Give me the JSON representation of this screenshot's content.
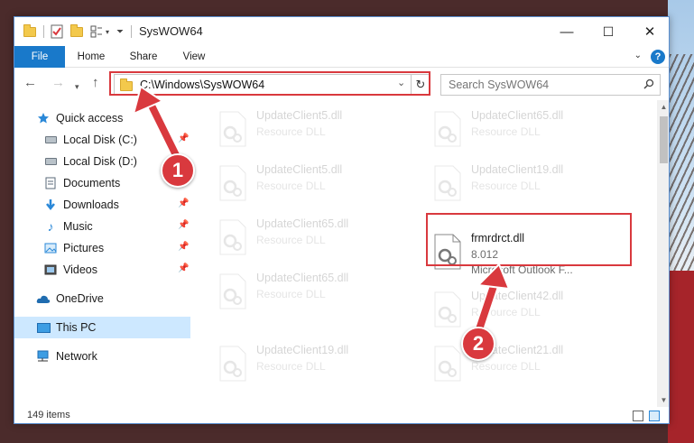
{
  "window": {
    "title": "SysWOW64",
    "buttons": {
      "minimize": "—",
      "maximize": "☐",
      "close": "✕"
    }
  },
  "ribbon": {
    "tabs": [
      {
        "label": "File"
      },
      {
        "label": "Home"
      },
      {
        "label": "Share"
      },
      {
        "label": "View"
      }
    ],
    "help": "?"
  },
  "navbar": {
    "address": "C:\\Windows\\SysWOW64",
    "search_placeholder": "Search SysWOW64"
  },
  "sidebar": {
    "items": [
      {
        "label": "Quick access",
        "icon": "star-icon"
      },
      {
        "label": "Local Disk (C:)",
        "icon": "disk-icon",
        "pinned": true
      },
      {
        "label": "Local Disk (D:)",
        "icon": "disk-icon",
        "pinned": false
      },
      {
        "label": "Documents",
        "icon": "documents-icon",
        "pinned": true
      },
      {
        "label": "Downloads",
        "icon": "downloads-icon",
        "pinned": true
      },
      {
        "label": "Music",
        "icon": "music-icon",
        "pinned": true
      },
      {
        "label": "Pictures",
        "icon": "pictures-icon",
        "pinned": true
      },
      {
        "label": "Videos",
        "icon": "videos-icon",
        "pinned": true
      },
      {
        "label": "OneDrive",
        "icon": "cloud-icon"
      },
      {
        "label": "This PC",
        "icon": "computer-icon",
        "selected": true
      },
      {
        "label": "Network",
        "icon": "network-icon"
      }
    ]
  },
  "files": [
    {
      "name": "UpdateClient5.dll",
      "desc": "Resource DLL"
    },
    {
      "name": "UpdateClient65.dll",
      "desc": "Resource DLL"
    },
    {
      "name": "UpdateClient5.dll",
      "desc": "Resource DLL"
    },
    {
      "name": "UpdateClient19.dll",
      "desc": "Resource DLL"
    },
    {
      "name": "UpdateClient65.dll",
      "desc": "Resource DLL"
    },
    {
      "name": "frmrdrct.dll",
      "desc": "8.012",
      "desc2": "Microsoft Outlook F..."
    },
    {
      "name": "UpdateClient65.dll",
      "desc": "Resource DLL"
    },
    {
      "name": "UpdateClient42.dll",
      "desc": "Resource DLL"
    },
    {
      "name": "UpdateClient19.dll",
      "desc": "Resource DLL"
    },
    {
      "name": "UpdateClient21.dll",
      "desc": "Resource DLL"
    }
  ],
  "status": {
    "item_count": "149 items"
  },
  "annotations": {
    "step1": "1",
    "step2": "2"
  },
  "colors": {
    "accent": "#1979ca",
    "highlight": "#d9393e",
    "selected_bg": "#cde8ff"
  }
}
